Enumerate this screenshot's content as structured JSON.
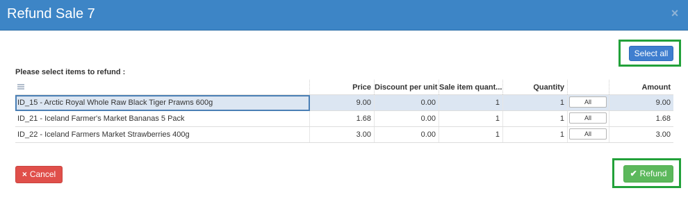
{
  "dialog": {
    "title": "Refund Sale 7",
    "close_glyph": "×",
    "select_all_label": "Select all",
    "prompt": "Please select items to refund :"
  },
  "table": {
    "header_icon": "list-icon",
    "columns": [
      "",
      "Price",
      "Discount per unit",
      "Sale item quant...",
      "Quantity",
      "",
      "Amount"
    ],
    "rows": [
      {
        "name": "ID_15 - Arctic Royal Whole Raw Black Tiger Prawns 600g",
        "price": "9.00",
        "discount": "0.00",
        "sale_qty": "1",
        "quantity": "1",
        "all_label": "All",
        "amount": "9.00",
        "selected": true
      },
      {
        "name": "ID_21 - Iceland Farmer's Market Bananas 5 Pack",
        "price": "1.68",
        "discount": "0.00",
        "sale_qty": "1",
        "quantity": "1",
        "all_label": "All",
        "amount": "1.68",
        "selected": false
      },
      {
        "name": "ID_22 - Iceland Farmers Market Strawberries 400g",
        "price": "3.00",
        "discount": "0.00",
        "sale_qty": "1",
        "quantity": "1",
        "all_label": "All",
        "amount": "3.00",
        "selected": false
      }
    ]
  },
  "footer": {
    "cancel_label": "Cancel",
    "cancel_icon": "×",
    "refund_label": "Refund",
    "refund_icon": "✔"
  },
  "colors": {
    "header": "#3d85c6",
    "primary": "#3f7ecf",
    "danger": "#e04f4a",
    "success": "#5cb85c",
    "highlight": "#22a13a",
    "selected_row": "#dce6f2"
  }
}
